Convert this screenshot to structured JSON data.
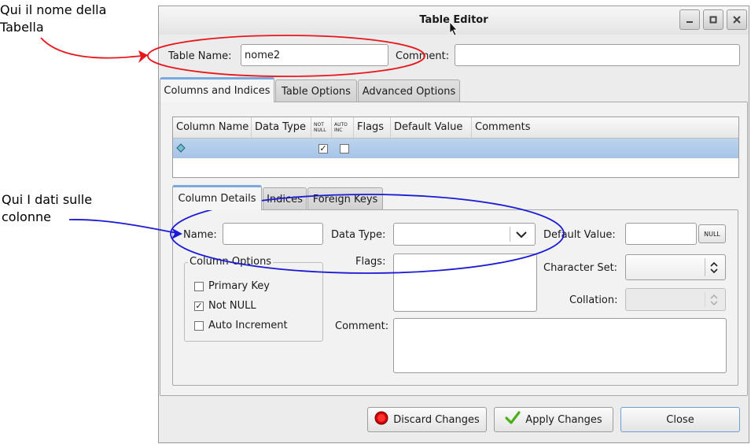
{
  "annotations": {
    "table_name_note": "Qui il nome della Tabella",
    "columns_note": "Qui I dati sulle colonne"
  },
  "window": {
    "title": "Table Editor",
    "controls": [
      "minimize-icon",
      "maximize-icon",
      "close-icon"
    ]
  },
  "header": {
    "table_name_label": "Table Name:",
    "table_name_value": "nome2",
    "comment_label": "Comment:",
    "comment_value": ""
  },
  "main_tabs": [
    {
      "label": "Columns and Indices",
      "active": true
    },
    {
      "label": "Table Options",
      "active": false
    },
    {
      "label": "Advanced Options",
      "active": false
    }
  ],
  "columns_table": {
    "headers": [
      "Column Name",
      "Data Type",
      "NOT NULL",
      "AUTO INC",
      "Flags",
      "Default Value",
      "Comments"
    ],
    "rows": [
      {
        "column_name": "",
        "data_type": "",
        "not_null": true,
        "auto_inc": false,
        "flags": "",
        "default_value": "",
        "comments": ""
      }
    ]
  },
  "detail_tabs": [
    {
      "label": "Column Details",
      "active": true
    },
    {
      "label": "Indices",
      "active": false
    },
    {
      "label": "Foreign Keys",
      "active": false
    }
  ],
  "column_details": {
    "name_label": "Name:",
    "name_value": "",
    "data_type_label": "Data Type:",
    "data_type_value": "",
    "default_value_label": "Default Value:",
    "default_value": "",
    "null_button": "NULL",
    "column_options_title": "Column Options",
    "options": [
      {
        "label": "Primary Key",
        "checked": false
      },
      {
        "label": "Not NULL",
        "checked": true
      },
      {
        "label": "Auto Increment",
        "checked": false
      }
    ],
    "flags_label": "Flags:",
    "character_set_label": "Character Set:",
    "character_set_value": "",
    "collation_label": "Collation:",
    "collation_value": "",
    "comment_label": "Comment:",
    "comment_value": ""
  },
  "footer": {
    "discard_label": "Discard Changes",
    "apply_label": "Apply Changes",
    "close_label": "Close"
  },
  "colors": {
    "annotation_red": "#e8161b",
    "annotation_blue": "#1a1ad6",
    "selection": "#aec8e8",
    "tab_accent": "#7aa7dd"
  }
}
